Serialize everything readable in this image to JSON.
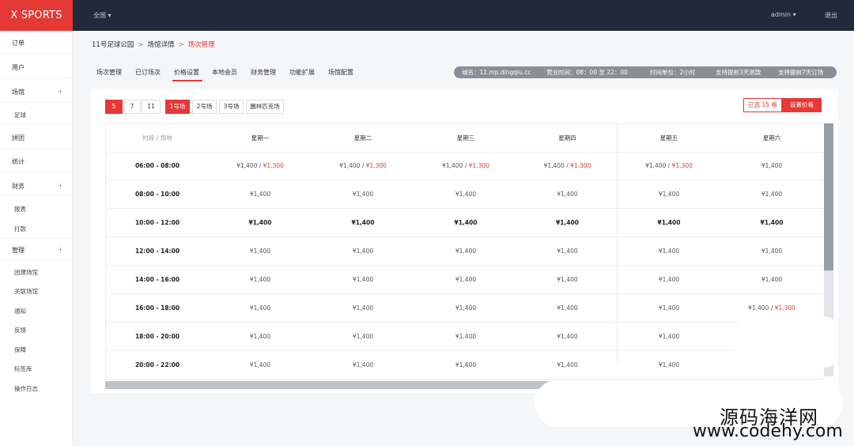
{
  "app": {
    "logo": "X SPORTS"
  },
  "topbar": {
    "city": "全国 ▾",
    "user": "admin ▾",
    "logout": "退出"
  },
  "sidebar": {
    "items": [
      {
        "label": "订单",
        "arrow": ""
      },
      {
        "label": "用户",
        "arrow": ""
      },
      {
        "label": "场馆",
        "arrow": "+"
      },
      {
        "label": "足球",
        "arrow": "",
        "sub": true
      },
      {
        "label": "拼团",
        "arrow": ""
      },
      {
        "label": "统计",
        "arrow": ""
      },
      {
        "label": "财务",
        "arrow": "+"
      },
      {
        "label": "报表",
        "arrow": "",
        "sub": true
      },
      {
        "label": "打款",
        "arrow": "",
        "sub": true
      },
      {
        "label": "管理",
        "arrow": "+"
      },
      {
        "label": "团建场馆",
        "arrow": "",
        "sub": true
      },
      {
        "label": "关联场馆",
        "arrow": "",
        "sub": true
      },
      {
        "label": "通知",
        "arrow": "",
        "sub": true
      },
      {
        "label": "反馈",
        "arrow": "",
        "sub": true
      },
      {
        "label": "保障",
        "arrow": "",
        "sub": true
      },
      {
        "label": "标签库",
        "arrow": "",
        "sub": true
      },
      {
        "label": "操作日志",
        "arrow": "",
        "sub": true
      }
    ]
  },
  "breadcrumb": {
    "a": "11号足球公园",
    "b": "场馆详情",
    "c": "场次管理",
    "sep": ">"
  },
  "tabs": [
    "场次管理",
    "已订场次",
    "价格设置",
    "本地会员",
    "财务管理",
    "功能扩展",
    "场馆配置"
  ],
  "info": {
    "domain": "域名：11.mp.dingqiu.cc",
    "hours": "营业时间：08：00 至 22：00",
    "unit": "时间单位：2小时",
    "advance": "支持提前3天退款",
    "book": "支持提前7天订场"
  },
  "filters": {
    "sizes": [
      "5",
      "7",
      "11"
    ],
    "fields": [
      "1号场",
      "2号场",
      "3号场",
      "園林匹克场"
    ]
  },
  "actions": {
    "selected": "已选 15 格",
    "set_price": "设置价格"
  },
  "table": {
    "corner": "时段 / 场地",
    "days": [
      "星期一",
      "星期二",
      "星期三",
      "星期四",
      "星期五",
      "星期六"
    ],
    "rows": [
      {
        "time": "06:00 - 08:00",
        "cells": [
          [
            "¥1,400 / ",
            "¥1,300"
          ],
          [
            "¥1,400 / ",
            "¥1,300"
          ],
          [
            "¥1,400 / ",
            "¥1,300"
          ],
          [
            "¥1,400 / ",
            "¥1,300"
          ],
          [
            "¥1,400 / ",
            "¥1,300"
          ],
          [
            "¥1,400",
            ""
          ]
        ]
      },
      {
        "time": "08:00 - 10:00",
        "cells": [
          [
            "¥1,400",
            ""
          ],
          [
            "¥1,400",
            ""
          ],
          [
            "¥1,400",
            ""
          ],
          [
            "¥1,400",
            ""
          ],
          [
            "¥1,400",
            ""
          ],
          [
            "¥1,400",
            ""
          ]
        ]
      },
      {
        "time": "10:00 - 12:00",
        "cells": [
          [
            "¥1,400",
            ""
          ],
          [
            "¥1,400",
            ""
          ],
          [
            "¥1,400",
            ""
          ],
          [
            "¥1,400",
            ""
          ],
          [
            "¥1,400",
            ""
          ],
          [
            "¥1,400",
            ""
          ]
        ]
      },
      {
        "time": "12:00 - 14:00",
        "cells": [
          [
            "¥1,400",
            ""
          ],
          [
            "¥1,400",
            ""
          ],
          [
            "¥1,400",
            ""
          ],
          [
            "¥1,400",
            ""
          ],
          [
            "¥1,400",
            ""
          ],
          [
            "¥1,400",
            ""
          ]
        ]
      },
      {
        "time": "14:00 - 16:00",
        "cells": [
          [
            "¥1,400",
            ""
          ],
          [
            "¥1,400",
            ""
          ],
          [
            "¥1,400",
            ""
          ],
          [
            "¥1,400",
            ""
          ],
          [
            "¥1,400",
            ""
          ],
          [
            "¥1,400",
            ""
          ]
        ]
      },
      {
        "time": "16:00 - 18:00",
        "cells": [
          [
            "¥1,400",
            ""
          ],
          [
            "¥1,400",
            ""
          ],
          [
            "¥1,400",
            ""
          ],
          [
            "¥1,400",
            ""
          ],
          [
            "¥1,400",
            ""
          ],
          [
            "¥1,400 / ",
            "¥1,300"
          ]
        ]
      },
      {
        "time": "18:00 - 20:00",
        "cells": [
          [
            "¥1,400",
            ""
          ],
          [
            "¥1,400",
            ""
          ],
          [
            "¥1,400",
            ""
          ],
          [
            "¥1,400",
            ""
          ],
          [
            "¥1,400",
            ""
          ],
          [
            "",
            ""
          ]
        ]
      },
      {
        "time": "20:00 - 22:00",
        "cells": [
          [
            "¥1,400",
            ""
          ],
          [
            "¥1,400",
            ""
          ],
          [
            "¥1,400",
            ""
          ],
          [
            "¥1,400",
            ""
          ],
          [
            "¥1,400",
            ""
          ],
          [
            "",
            ""
          ]
        ]
      }
    ]
  },
  "watermark": {
    "cn": "源码海洋网",
    "en": "www.codehy.com"
  },
  "colors": {
    "accent": "#e53935",
    "topbar": "#1f2a3a"
  }
}
